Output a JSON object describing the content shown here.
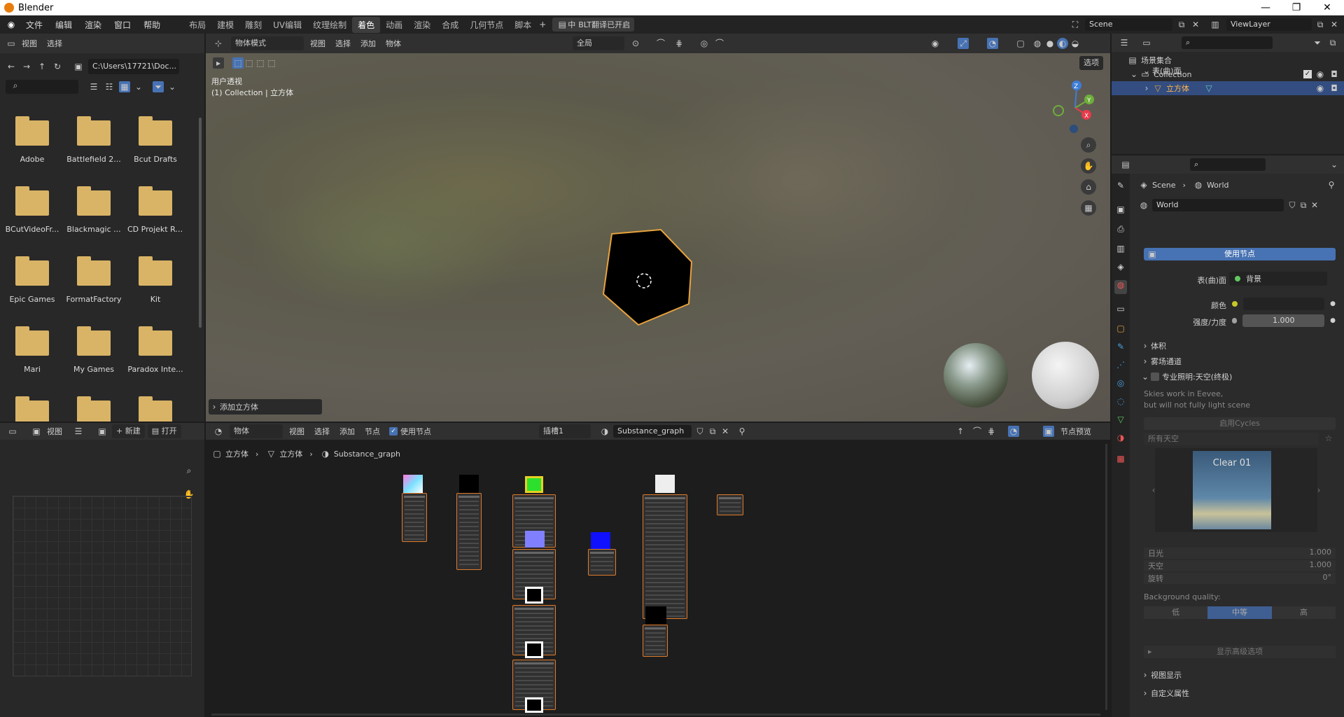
{
  "app": {
    "title": "Blender"
  },
  "menus": [
    "文件",
    "编辑",
    "渲染",
    "窗口",
    "帮助"
  ],
  "workspaces": [
    "布局",
    "建模",
    "雕刻",
    "UV编辑",
    "纹理绘制",
    "着色",
    "动画",
    "渲染",
    "合成",
    "几何节点",
    "脚本"
  ],
  "active_workspace_index": 5,
  "plugin_label": "BLT翻译已开启",
  "plugin_lang": "中",
  "scene": "Scene",
  "view_layer": "ViewLayer",
  "filebrowser": {
    "menu_view": "视图",
    "menu_select": "选择",
    "path": "C:\\Users\\17721\\Doc...",
    "folders": [
      "Adobe",
      "Battlefield 2...",
      "Bcut Drafts",
      "BCutVideoFr...",
      "Blackmagic ...",
      "CD Projekt Red",
      "Epic Games",
      "FormatFactory",
      "Kit",
      "Mari",
      "My Games",
      "Paradox Inte...",
      "",
      "",
      ""
    ]
  },
  "viewport": {
    "mode": "物体模式",
    "menu": [
      "视图",
      "选择",
      "添加",
      "物体"
    ],
    "transform": "全局",
    "options": "选项",
    "view_name": "用户透视",
    "collection_line": "(1) Collection | 立方体",
    "last_op": "添加立方体",
    "gizmo": {
      "z": "Z",
      "y": "Y",
      "x": "X"
    }
  },
  "outliner": {
    "root": "场景集合",
    "collection": "Collection",
    "object": "立方体"
  },
  "image_editor": {
    "menu_view": "视图",
    "new": "新建",
    "open": "打开"
  },
  "node_editor": {
    "type": "物体",
    "menu": [
      "视图",
      "选择",
      "添加",
      "节点"
    ],
    "use_nodes": "使用节点",
    "slot": "插槽1",
    "material": "Substance_graph",
    "preview": "节点预览",
    "breadcrumb": [
      "立方体",
      "立方体",
      "Substance_graph"
    ]
  },
  "properties": {
    "breadcrumb": [
      "Scene",
      "World"
    ],
    "world_name": "World",
    "surface_panel": "表(曲)面",
    "use_nodes_btn": "使用节点",
    "surface_label": "表(曲)面",
    "surface_value": "背景",
    "color_label": "颜色",
    "strength_label": "强度/力度",
    "strength_value": "1.000",
    "volume_panel": "体积",
    "mist_panel": "雾场通道",
    "pro_lighting_panel": "专业照明:天空(终极)",
    "note_line1": "Skies work in Eevee,",
    "note_line2": "but will not fully light scene",
    "enable_cycles": "启用Cycles",
    "all_skies": "所有天空",
    "sky_preview": "Clear 01",
    "sun_label": "日光",
    "sun_value": "1.000",
    "sky_label": "天空",
    "sky_value": "1.000",
    "rot_label": "旋转",
    "rot_value": "0°",
    "bg_quality": "Background quality:",
    "quality_options": [
      "低",
      "中等",
      "高"
    ],
    "quality_selected": 1,
    "show_advanced": "显示高级选项",
    "viewport_display": "视图显示",
    "custom_props": "自定义属性"
  },
  "colors": {
    "accent": "#4772b3",
    "selected_outline": "#e8a33c",
    "node_border": "#e07b2a",
    "header": "#303030"
  }
}
